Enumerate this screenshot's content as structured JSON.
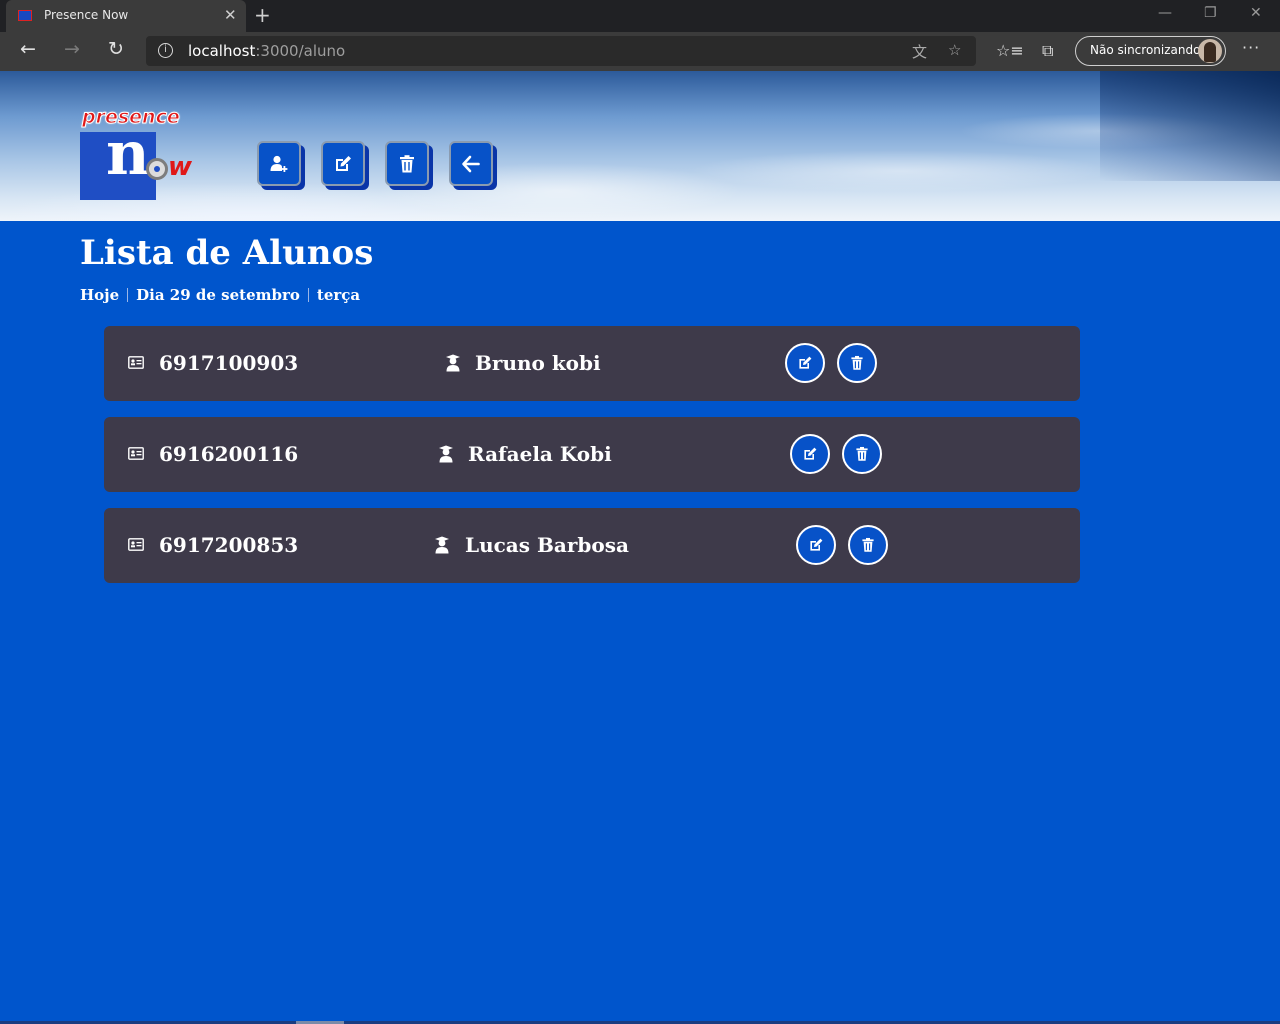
{
  "browser": {
    "tab_title": "Presence Now",
    "tab_close": "✕",
    "new_tab": "+",
    "url_host": "localhost",
    "url_path": ":3000/aluno",
    "profile_label": "Não sincronizando",
    "more": "···",
    "info_icon": "i",
    "icons": {
      "back": "back-arrow-icon",
      "forward": "forward-arrow-icon",
      "refresh": "refresh-icon",
      "translate": "translate-icon",
      "favorite": "star-icon",
      "favorites_bar": "favorites-list-icon",
      "collections": "collections-icon"
    }
  },
  "header": {
    "logo_top": "presence",
    "logo_n": "n",
    "logo_w": "w",
    "buttons": [
      {
        "name": "add-aluno-button",
        "icon": "user-plus-icon"
      },
      {
        "name": "edit-button",
        "icon": "edit-icon"
      },
      {
        "name": "delete-button",
        "icon": "trash-icon"
      },
      {
        "name": "back-button",
        "icon": "arrow-left-icon"
      }
    ]
  },
  "main": {
    "title": "Lista de Alunos",
    "subnav": [
      "Hoje",
      "Dia 29 de setembro",
      "terça"
    ]
  },
  "alunos": [
    {
      "id": "6917100903",
      "name": "Bruno kobi"
    },
    {
      "id": "6916200116",
      "name": "Rafaela Kobi"
    },
    {
      "id": "6917200853",
      "name": "Lucas Barbosa"
    }
  ],
  "colors": {
    "page_bg": "#0055cc",
    "card_bg": "#3e3a4a",
    "button_bg": "#0752c8",
    "chrome_dark": "#202124",
    "chrome_toolbar": "#3b3b3b"
  }
}
